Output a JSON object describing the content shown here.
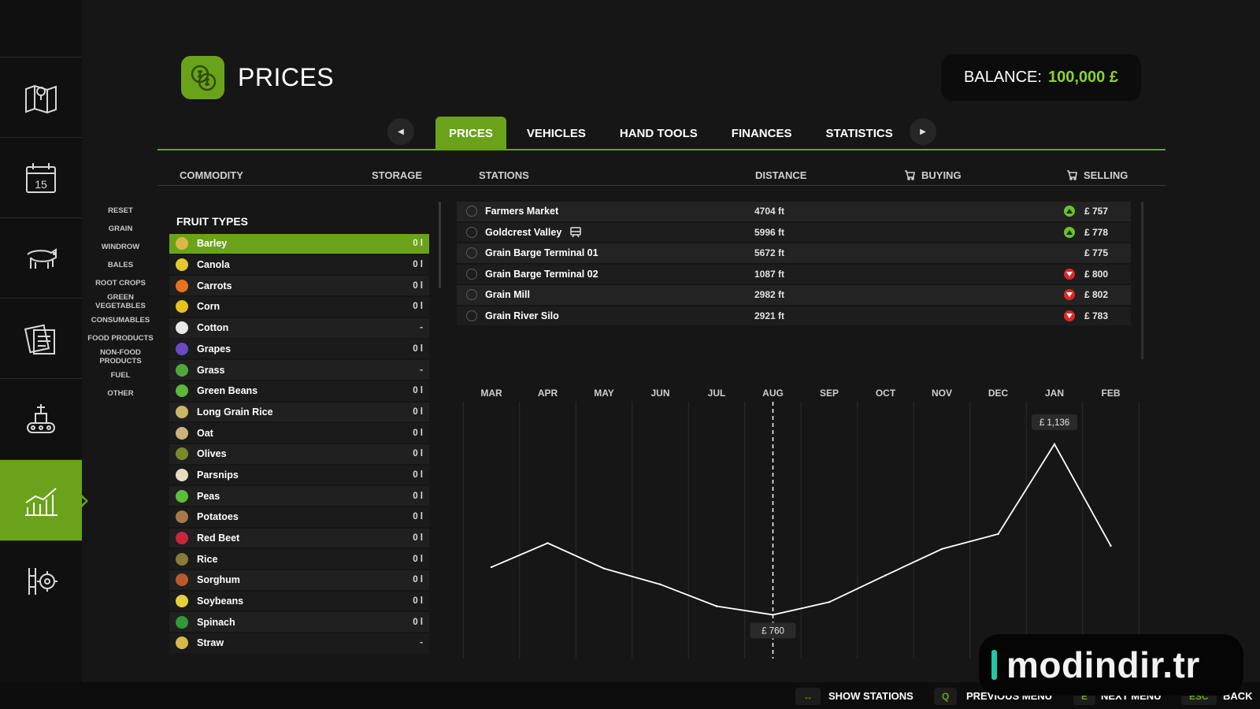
{
  "page": {
    "title": "PRICES"
  },
  "balance": {
    "label": "BALANCE:",
    "value": "100,000 £"
  },
  "tabs": [
    {
      "label": "PRICES",
      "active": true
    },
    {
      "label": "VEHICLES",
      "active": false
    },
    {
      "label": "HAND TOOLS",
      "active": false
    },
    {
      "label": "FINANCES",
      "active": false
    },
    {
      "label": "STATISTICS",
      "active": false
    }
  ],
  "columns": {
    "commodity": "COMMODITY",
    "storage": "STORAGE",
    "stations": "STATIONS",
    "distance": "DISTANCE",
    "buying": "BUYING",
    "selling": "SELLING"
  },
  "filters": [
    "RESET",
    "GRAIN",
    "WINDROW",
    "BALES",
    "ROOT CROPS",
    "GREEN VEGETABLES",
    "CONSUMABLES",
    "FOOD PRODUCTS",
    "NON-FOOD PRODUCTS",
    "FUEL",
    "OTHER"
  ],
  "fruit_section_title": "FRUIT TYPES",
  "fruits": [
    {
      "name": "Barley",
      "storage": "0 l",
      "color": "#d9b84a"
    },
    {
      "name": "Canola",
      "storage": "0 l",
      "color": "#e3c830"
    },
    {
      "name": "Carrots",
      "storage": "0 l",
      "color": "#e8731e"
    },
    {
      "name": "Corn",
      "storage": "0 l",
      "color": "#e6c21e"
    },
    {
      "name": "Cotton",
      "storage": "-",
      "color": "#e8e8e8"
    },
    {
      "name": "Grapes",
      "storage": "0 l",
      "color": "#6a4ac2"
    },
    {
      "name": "Grass",
      "storage": "-",
      "color": "#4da83a"
    },
    {
      "name": "Green Beans",
      "storage": "0 l",
      "color": "#5cb83a"
    },
    {
      "name": "Long Grain Rice",
      "storage": "0 l",
      "color": "#c9b86a"
    },
    {
      "name": "Oat",
      "storage": "0 l",
      "color": "#cdb27a"
    },
    {
      "name": "Olives",
      "storage": "0 l",
      "color": "#7a8a2a"
    },
    {
      "name": "Parsnips",
      "storage": "0 l",
      "color": "#e8dcc0"
    },
    {
      "name": "Peas",
      "storage": "0 l",
      "color": "#5cbf3a"
    },
    {
      "name": "Potatoes",
      "storage": "0 l",
      "color": "#a8784a"
    },
    {
      "name": "Red Beet",
      "storage": "0 l",
      "color": "#c8263a"
    },
    {
      "name": "Rice",
      "storage": "0 l",
      "color": "#8a7a3a"
    },
    {
      "name": "Sorghum",
      "storage": "0 l",
      "color": "#b85a2a"
    },
    {
      "name": "Soybeans",
      "storage": "0 l",
      "color": "#e6cf3a"
    },
    {
      "name": "Spinach",
      "storage": "0 l",
      "color": "#2e9a3a"
    },
    {
      "name": "Straw",
      "storage": "-",
      "color": "#d9b84a"
    }
  ],
  "stations": [
    {
      "name": "Farmers Market",
      "distance": "4704 ft",
      "trend": "up",
      "price": "£ 757",
      "train": false
    },
    {
      "name": "Goldcrest Valley",
      "distance": "5996 ft",
      "trend": "up",
      "price": "£ 778",
      "train": true
    },
    {
      "name": "Grain Barge Terminal 01",
      "distance": "5672 ft",
      "trend": "none",
      "price": "£ 775",
      "train": false
    },
    {
      "name": "Grain Barge Terminal 02",
      "distance": "1087 ft",
      "trend": "down",
      "price": "£ 800",
      "train": false
    },
    {
      "name": "Grain Mill",
      "distance": "2982 ft",
      "trend": "down",
      "price": "£ 802",
      "train": false
    },
    {
      "name": "Grain River Silo",
      "distance": "2921 ft",
      "trend": "down",
      "price": "£ 783",
      "train": false
    }
  ],
  "chart_data": {
    "type": "line",
    "categories": [
      "MAR",
      "APR",
      "MAY",
      "JUN",
      "JUL",
      "AUG",
      "SEP",
      "OCT",
      "NOV",
      "DEC",
      "JAN",
      "FEB"
    ],
    "series": [
      {
        "values": [
          865,
          918,
          862,
          827,
          779,
          760,
          788,
          847,
          905,
          938,
          1136,
          912
        ]
      }
    ],
    "ylim": [
      700,
      1160
    ],
    "current_month": "AUG",
    "annotations": [
      {
        "category": "JAN",
        "label": "£ 1,136"
      },
      {
        "category": "AUG",
        "label": "£ 760"
      }
    ],
    "grid": true
  },
  "footer": {
    "actions": [
      {
        "key": "↔",
        "label": "SHOW STATIONS"
      },
      {
        "key": "Q",
        "label": "PREVIOUS MENU"
      },
      {
        "key": "E",
        "label": "NEXT MENU"
      },
      {
        "key": "ESC",
        "label": "BACK"
      }
    ]
  },
  "watermark": {
    "text": "modindir.tr"
  },
  "colors": {
    "accent": "#6aa31a",
    "balance": "#8bd42a",
    "up": "#6cc12a",
    "down": "#e02626"
  }
}
